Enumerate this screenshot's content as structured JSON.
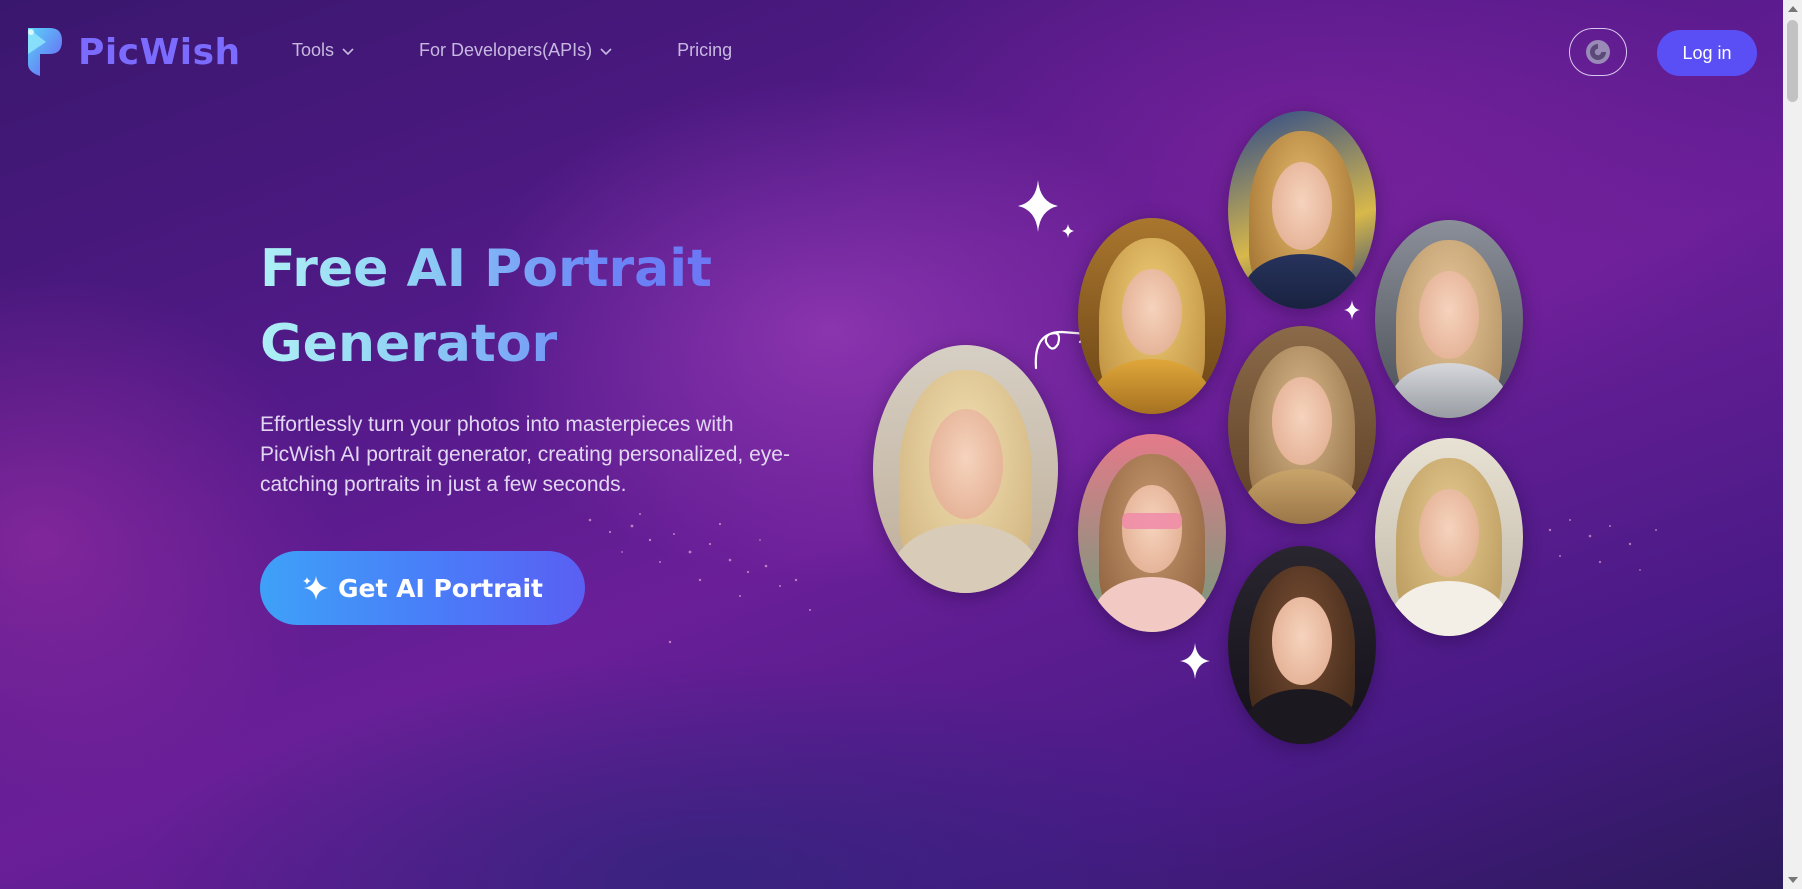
{
  "brand": {
    "name": "PicWish",
    "logo_icon": "picwish-logo-icon",
    "color": "#7b6cff"
  },
  "nav": {
    "tools": "Tools",
    "developers": "For Developers(APIs)",
    "pricing": "Pricing"
  },
  "header": {
    "theme_icon": "theme-toggle-icon",
    "login": "Log in",
    "login_color": "#5a4ff5"
  },
  "hero": {
    "title_line1": "Free AI Portrait",
    "title_line2": "Generator",
    "description": "Effortlessly turn your photos into masterpieces with PicWish AI portrait generator, creating personalized, eye-catching portraits in just a few seconds.",
    "cta": "Get AI Portrait",
    "cta_icon": "sparkle-icon"
  },
  "portraits": [
    {
      "name": "portrait-blonde-casual"
    },
    {
      "name": "portrait-golden-necklace"
    },
    {
      "name": "portrait-starry-night"
    },
    {
      "name": "portrait-jeweled-headpiece"
    },
    {
      "name": "portrait-pink-sunglasses"
    },
    {
      "name": "portrait-astronaut"
    },
    {
      "name": "portrait-white-scarf"
    },
    {
      "name": "portrait-dark-hood"
    }
  ]
}
